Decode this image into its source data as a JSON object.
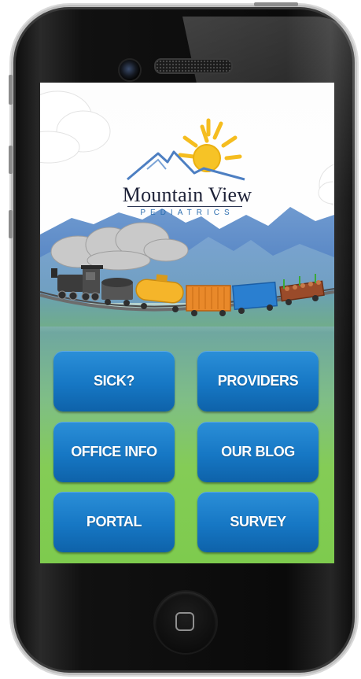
{
  "app": {
    "brand_title": "Mountain View",
    "brand_subtitle": "PEDIATRICS"
  },
  "menu": {
    "buttons": [
      {
        "label": "SICK?"
      },
      {
        "label": "PROVIDERS"
      },
      {
        "label": "OFFICE INFO"
      },
      {
        "label": "OUR BLOG"
      },
      {
        "label": "PORTAL"
      },
      {
        "label": "SURVEY"
      }
    ]
  },
  "colors": {
    "button_blue": "#1677c4",
    "grass_green": "#84cc56",
    "mountain_blue": "#5d89c7",
    "sun_yellow": "#f5bd1f"
  },
  "icons": {
    "logo": "mountain-sun-logo",
    "home": "home-button-icon"
  }
}
